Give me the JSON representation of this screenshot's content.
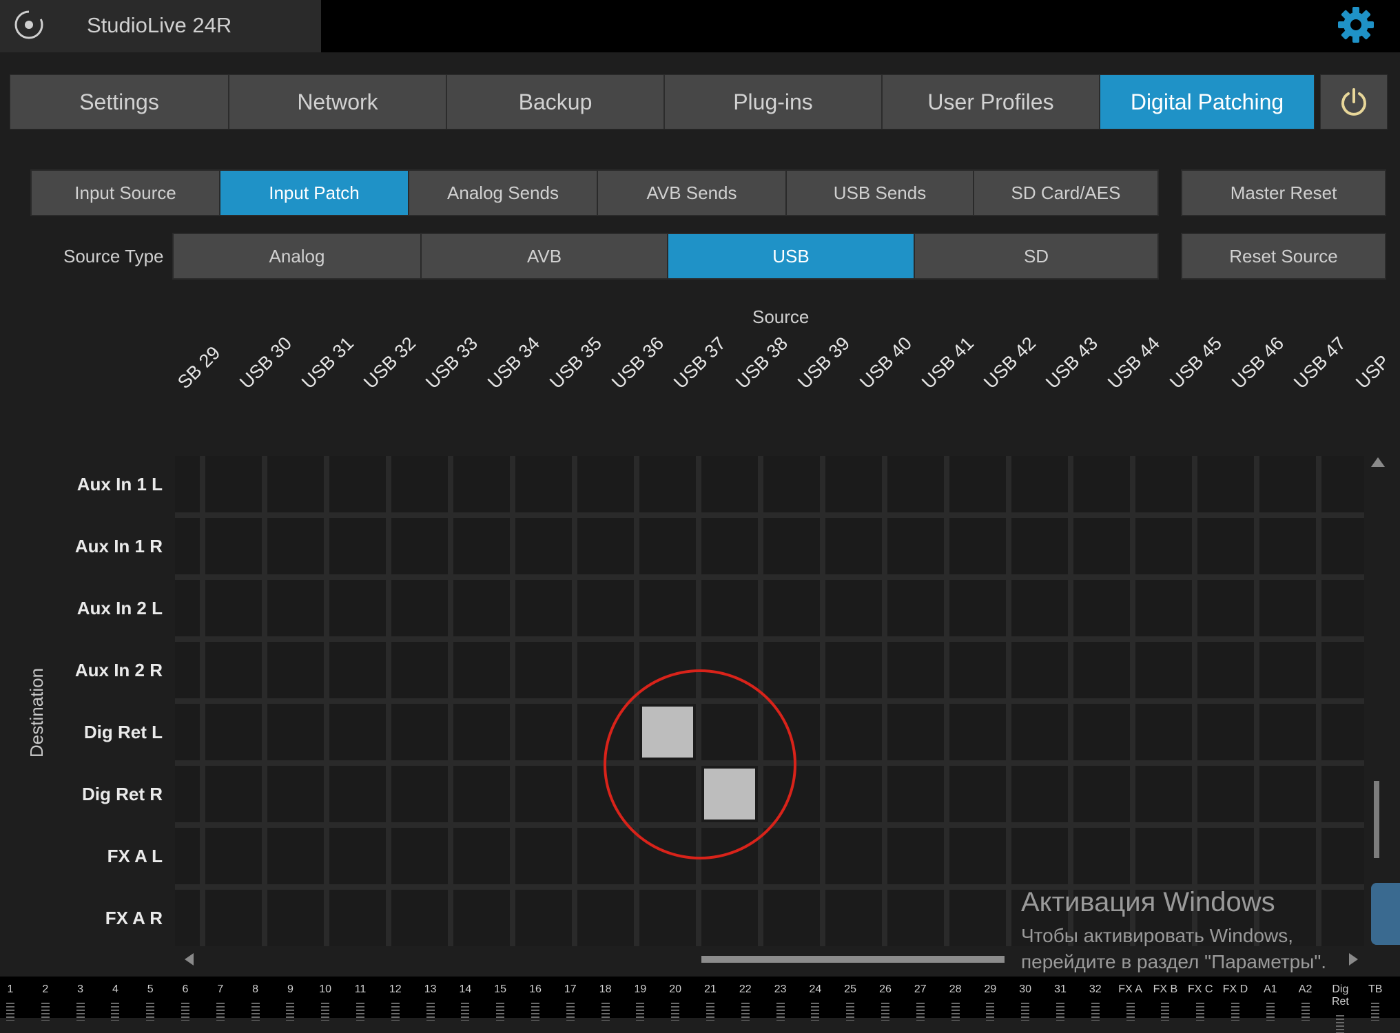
{
  "app": {
    "title": "StudioLive 24R"
  },
  "main_tabs": [
    "Settings",
    "Network",
    "Backup",
    "Plug-ins",
    "User Profiles",
    "Digital Patching"
  ],
  "main_tab_active": "Digital Patching",
  "sub_tabs": [
    "Input Source",
    "Input Patch",
    "Analog Sends",
    "AVB Sends",
    "USB Sends",
    "SD Card/AES"
  ],
  "sub_tab_active": "Input Patch",
  "master_reset_label": "Master Reset",
  "source_type": {
    "label": "Source Type",
    "options": [
      "Analog",
      "AVB",
      "USB",
      "SD"
    ],
    "active": "USB"
  },
  "reset_source_label": "Reset Source",
  "source_header": "Source",
  "destination_header": "Destination",
  "columns": [
    "SB 29",
    "USB 30",
    "USB 31",
    "USB 32",
    "USB 33",
    "USB 34",
    "USB 35",
    "USB 36",
    "USB 37",
    "USB 38",
    "USB 39",
    "USB 40",
    "USB 41",
    "USB 42",
    "USB 43",
    "USB 44",
    "USB 45",
    "USB 46",
    "USB 47",
    "USP"
  ],
  "rows": [
    "Aux In 1 L",
    "Aux In 1  R",
    "Aux In 2 L",
    "Aux In 2  R",
    "Dig Ret L",
    "Dig Ret  R",
    "FX A L",
    "FX A  R"
  ],
  "patched": [
    {
      "row": "Dig Ret L",
      "column": "USB 37"
    },
    {
      "row": "Dig Ret  R",
      "column": "USB 38"
    }
  ],
  "watermark": {
    "line1": "Активация Windows",
    "line2": "Чтобы активировать Windows,",
    "line3": "перейдите в раздел \"Параметры\"."
  },
  "meters": [
    "1",
    "2",
    "3",
    "4",
    "5",
    "6",
    "7",
    "8",
    "9",
    "10",
    "11",
    "12",
    "13",
    "14",
    "15",
    "16",
    "17",
    "18",
    "19",
    "20",
    "21",
    "22",
    "23",
    "24",
    "25",
    "26",
    "27",
    "28",
    "29",
    "30",
    "31",
    "32",
    "FX A",
    "FX B",
    "FX C",
    "FX D",
    "A1",
    "A2",
    "Dig Ret",
    "TB"
  ],
  "colors": {
    "accent": "#1f92c7",
    "annotation_circle": "#d9231a",
    "patched_cell": "#bdbdbd"
  }
}
